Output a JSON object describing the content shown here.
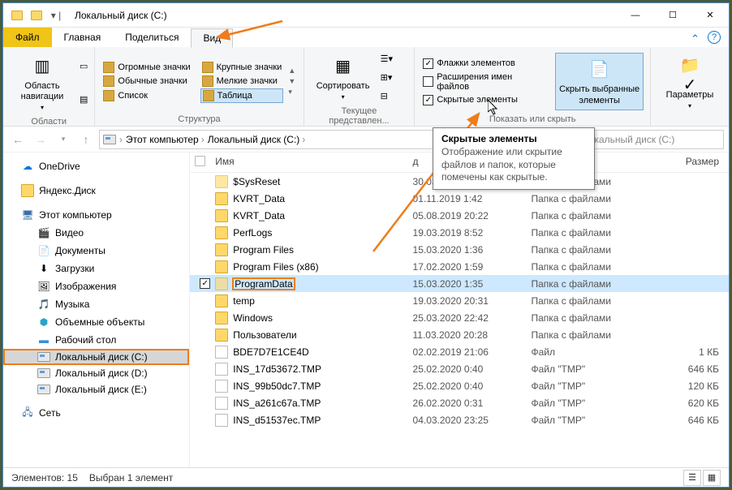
{
  "title": {
    "path_label": "Локальный диск (C:)"
  },
  "tabs": {
    "file": "Файл",
    "home": "Главная",
    "share": "Поделиться",
    "view": "Вид"
  },
  "ribbon": {
    "panes": {
      "label": "Области",
      "nav_btn": "Область навигации"
    },
    "layout": {
      "label": "Структура",
      "items": [
        "Огромные значки",
        "Крупные значки",
        "Обычные значки",
        "Мелкие значки",
        "Список",
        "Таблица"
      ]
    },
    "current_view": {
      "label": "Текущее представлен...",
      "sort_btn": "Сортировать"
    },
    "show_hide": {
      "label": "Показать или скрыть",
      "item_checkboxes": "Флажки элементов",
      "file_ext": "Расширения имен файлов",
      "hidden_items": "Скрытые элементы",
      "hide_selected": "Скрыть выбранные элементы"
    },
    "options": {
      "label": "",
      "btn": "Параметры"
    }
  },
  "tooltip": {
    "title": "Скрытые элементы",
    "body": "Отображение или скрытие файлов и папок, которые помечены как скрытые."
  },
  "address": {
    "crumb1": "Этот компьютер",
    "crumb2": "Локальный диск (C:)"
  },
  "search": {
    "placeholder": "к: Локальный диск (C:)"
  },
  "nav_items": {
    "onedrive": "OneDrive",
    "yandex": "Яндекс.Диск",
    "thispc": "Этот компьютер",
    "video": "Видео",
    "docs": "Документы",
    "downloads": "Загрузки",
    "pictures": "Изображения",
    "music": "Музыка",
    "objects3d": "Объемные объекты",
    "desktop": "Рабочий стол",
    "drive_c": "Локальный диск (C:)",
    "drive_d": "Локальный диск (D:)",
    "drive_e": "Локальный диск (E:)",
    "network": "Сеть"
  },
  "columns": {
    "name": "Имя",
    "date": "д",
    "type": "",
    "size": "Размер"
  },
  "files": [
    {
      "icon": "folder",
      "name": "$SysReset",
      "date": "30.03.2020 0:15",
      "type": "Папка с файлами",
      "size": "",
      "hidden": true
    },
    {
      "icon": "folder",
      "name": "KVRT_Data",
      "date": "01.11.2019 1:42",
      "type": "Папка с файлами",
      "size": ""
    },
    {
      "icon": "folder",
      "name": "KVRT_Data",
      "date": "05.08.2019 20:22",
      "type": "Папка с файлами",
      "size": ""
    },
    {
      "icon": "folder",
      "name": "PerfLogs",
      "date": "19.03.2019 8:52",
      "type": "Папка с файлами",
      "size": ""
    },
    {
      "icon": "folder",
      "name": "Program Files",
      "date": "15.03.2020 1:36",
      "type": "Папка с файлами",
      "size": ""
    },
    {
      "icon": "folder",
      "name": "Program Files (x86)",
      "date": "17.02.2020 1:59",
      "type": "Папка с файлами",
      "size": ""
    },
    {
      "icon": "folder",
      "name": "ProgramData",
      "date": "15.03.2020 1:35",
      "type": "Папка с файлами",
      "size": "",
      "hidden": true,
      "selected": true,
      "hl": true
    },
    {
      "icon": "folder",
      "name": "temp",
      "date": "19.03.2020 20:31",
      "type": "Папка с файлами",
      "size": ""
    },
    {
      "icon": "folder",
      "name": "Windows",
      "date": "25.03.2020 22:42",
      "type": "Папка с файлами",
      "size": ""
    },
    {
      "icon": "folder",
      "name": "Пользователи",
      "date": "11.03.2020 20:28",
      "type": "Папка с файлами",
      "size": ""
    },
    {
      "icon": "file",
      "name": "BDE7D7E1CE4D",
      "date": "02.02.2019 21:06",
      "type": "Файл",
      "size": "1 КБ"
    },
    {
      "icon": "file",
      "name": "INS_17d53672.TMP",
      "date": "25.02.2020 0:40",
      "type": "Файл \"TMP\"",
      "size": "646 КБ"
    },
    {
      "icon": "file",
      "name": "INS_99b50dc7.TMP",
      "date": "25.02.2020 0:40",
      "type": "Файл \"TMP\"",
      "size": "120 КБ"
    },
    {
      "icon": "file",
      "name": "INS_a261c67a.TMP",
      "date": "26.02.2020 0:31",
      "type": "Файл \"TMP\"",
      "size": "620 КБ"
    },
    {
      "icon": "file",
      "name": "INS_d51537ec.TMP",
      "date": "04.03.2020 23:25",
      "type": "Файл \"TMP\"",
      "size": "646 КБ"
    }
  ],
  "status": {
    "count": "Элементов: 15",
    "sel": "Выбран 1 элемент"
  }
}
